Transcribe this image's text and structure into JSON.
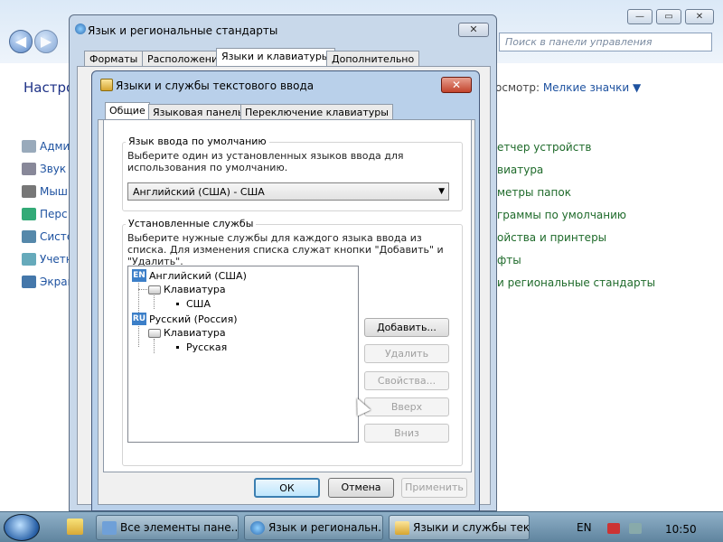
{
  "control_panel": {
    "search_placeholder": "Поиск в панели управления",
    "heading": "Настро",
    "view_label": "осмотр:",
    "view_value": "Мелкие значки",
    "left_items": [
      "Адми",
      "Звук",
      "Мыш",
      "Перс",
      "Систе",
      "Учетн",
      "Экран"
    ],
    "right_items": [
      "етчер устройств",
      "виатура",
      "метры папок",
      "граммы по умолчанию",
      "ойства и принтеры",
      "фты",
      "и региональные стандарты"
    ]
  },
  "window1": {
    "title": "Язык и региональные стандарты",
    "tabs": [
      "Форматы",
      "Расположение",
      "Языки и клавиатуры",
      "Дополнительно"
    ],
    "selected_tab": 2,
    "apply_label": "Применить"
  },
  "dialog": {
    "title": "Языки и службы текстового ввода",
    "close_symbol": "✕",
    "tabs": [
      "Общие",
      "Языковая панель",
      "Переключение клавиатуры"
    ],
    "selected_tab": 0,
    "default_group": {
      "label": "Язык ввода по умолчанию",
      "description": "Выберите один из установленных языков ввода для использования по умолчанию.",
      "selected": "Английский (США) - США"
    },
    "services_group": {
      "label": "Установленные службы",
      "description": "Выберите нужные службы для каждого языка ввода из списка. Для изменения списка служат кнопки \"Добавить\" и \"Удалить\"."
    },
    "tree": {
      "lang1": {
        "code": "EN",
        "name": "Английский (США)",
        "category": "Клавиатура",
        "layout": "США"
      },
      "lang2": {
        "code": "RU",
        "name": "Русский (Россия)",
        "category": "Клавиатура",
        "layout": "Русская"
      }
    },
    "buttons": {
      "add": "Добавить...",
      "remove": "Удалить",
      "properties": "Свойства...",
      "up": "Вверх",
      "down": "Вниз",
      "ok": "ОК",
      "cancel": "Отмена",
      "apply": "Применить"
    }
  },
  "taskbar": {
    "items": [
      "Все элементы пане...",
      "Язык и региональн...",
      "Языки и службы тек..."
    ],
    "language": "EN",
    "clock": "10:50"
  }
}
